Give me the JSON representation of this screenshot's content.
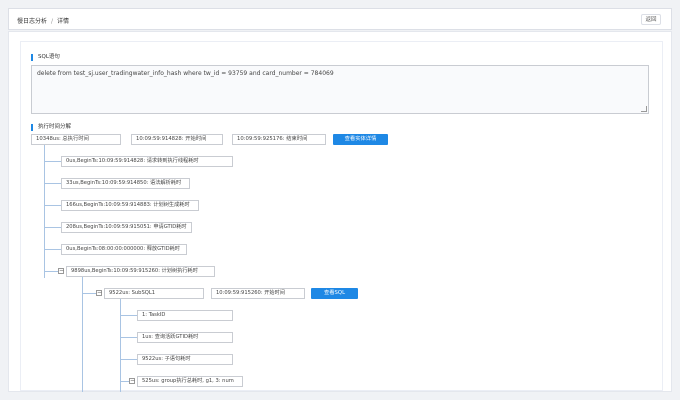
{
  "breadcrumb": {
    "root": "慢日志分析",
    "separator": "/",
    "current": "详情"
  },
  "header": {
    "back_label": "返回"
  },
  "sql_section": {
    "title": "SQL语句",
    "statement": "delete from test_sj.user_tradingwater_info_hash where tw_id = 93759 and card_number = 784069"
  },
  "exec_section": {
    "title": "执行时间分解",
    "total_time": "10348us: 总执行时间",
    "start_time": "10:09:59:914828: 开始时间",
    "end_time": "10:09:59:925176: 结束时间",
    "detail_button": "查看实体详情"
  },
  "tree": {
    "steps": [
      "0us,BeginTs:10:09:59:914828: 请求转到执行线程耗时",
      "33us,BeginTs:10:09:59:914850: 语法解析耗时",
      "166us,BeginTs:10:09:59:914883: 计划树生成耗时",
      "208us,BeginTs:10:09:59:915051: 申请GTID耗时",
      "0us,BeginTs:08:00:00:000000: 释放GTID耗时",
      "9898us,BeginTs:10:09:59:915260: 计划树执行耗时"
    ],
    "subsql": {
      "label": "9522us: SubSQL1",
      "start": "10:09:59:915260: 开始时间",
      "view_sql_button": "查看SQL"
    },
    "sub_items": [
      "1: TaskID",
      "1us: 查询活跃GTID耗时",
      "9522us: 子语句耗时",
      "525us: group执行总耗时, g1, 3: num"
    ],
    "collapse_symbol": "−"
  },
  "colors": {
    "accent": "#1e88e5",
    "tree_line": "#a9c4e3"
  }
}
